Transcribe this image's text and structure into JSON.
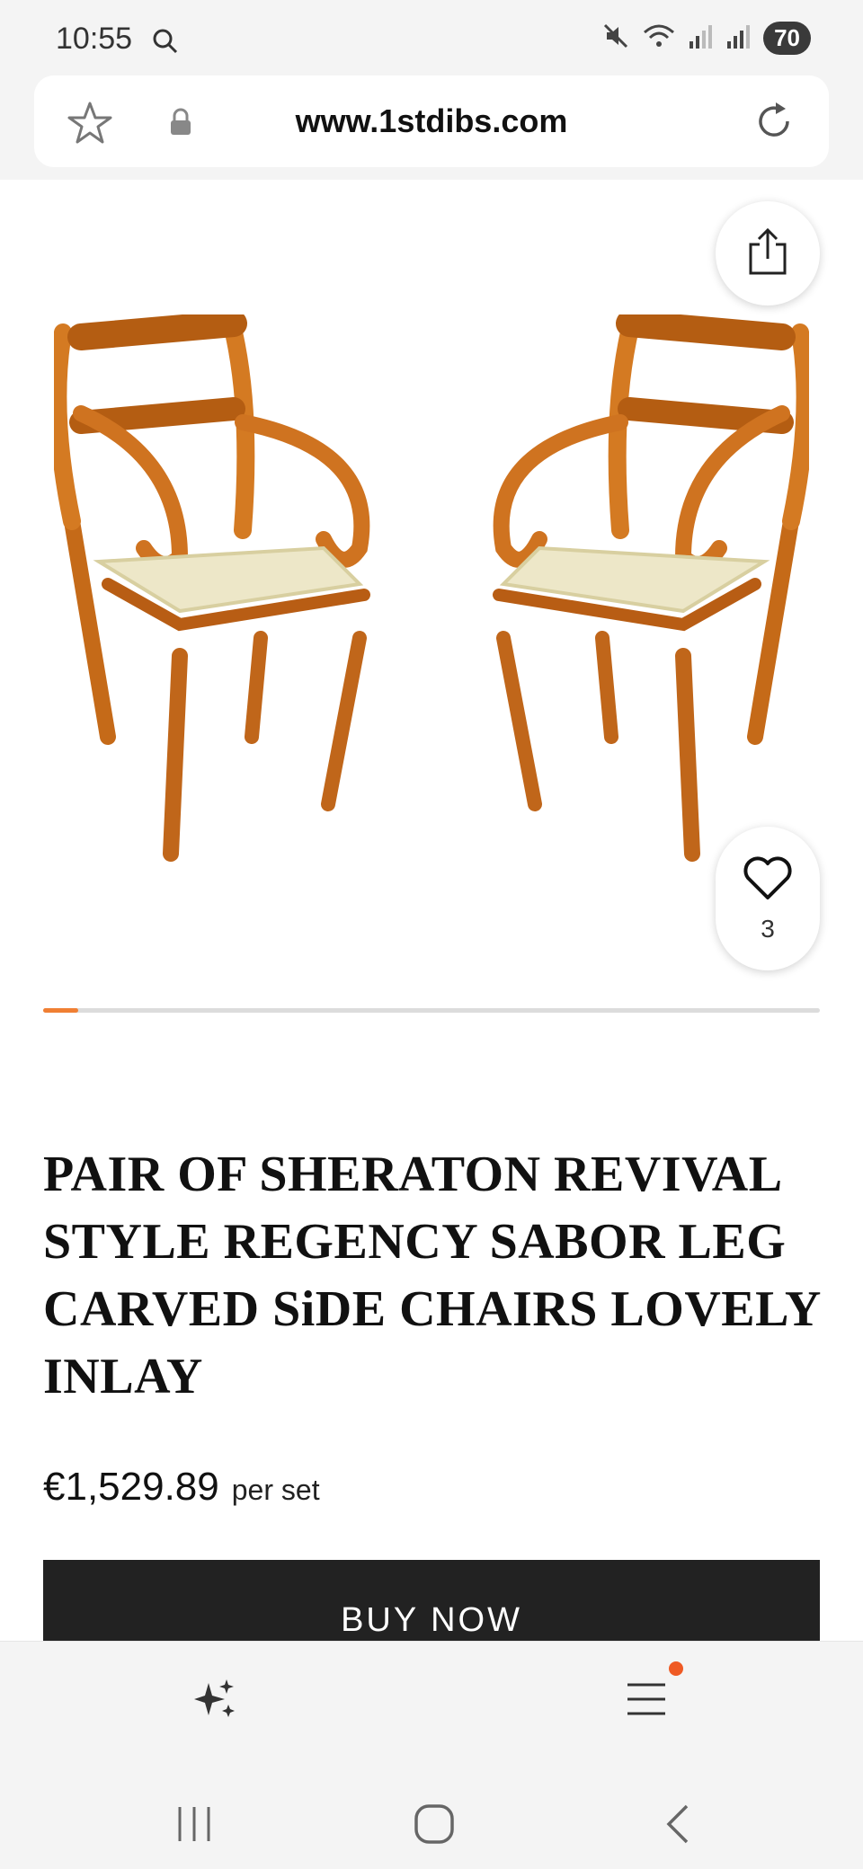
{
  "status_bar": {
    "time": "10:55",
    "battery": "70",
    "icons": [
      "search-icon",
      "mute-icon",
      "wifi-icon",
      "signal-icon",
      "signal-icon"
    ]
  },
  "browser": {
    "url": "www.1stdibs.com",
    "icons": [
      "star-icon",
      "lock-icon",
      "reload-icon"
    ]
  },
  "product": {
    "image_alt": "Pair of yew wood armchairs with striped upholstered seats",
    "favorite_count": "3",
    "carousel_progress": 0.045,
    "title": "PAIR OF SHERATON REVIVAL STYLE REGENCY SABOR LEG CARVED SiDE CHAIRS LOVELY INLAY",
    "price": "€1,529.89",
    "price_unit": "per set",
    "buy_label": "BUY NOW"
  },
  "bottom_nav": {
    "icons": [
      "sparkle-icon",
      "menu-icon"
    ],
    "notification_color": "#ef5a24"
  },
  "colors": {
    "accent": "#f07f33",
    "button": "#222222"
  }
}
